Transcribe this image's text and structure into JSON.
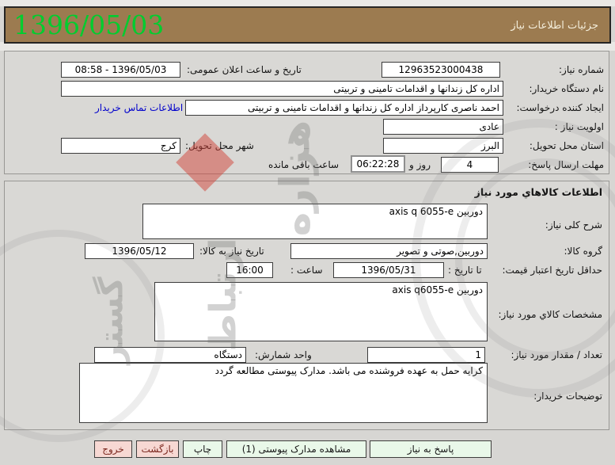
{
  "header": {
    "title": "جزئیات اطلاعات نیاز",
    "date": "1396/05/03",
    "colors": {
      "bar_bg": "#9c7b50",
      "date_green": "#00cd2f"
    }
  },
  "general": {
    "need_number_label": "شماره نیاز:",
    "need_number": "12963523000438",
    "announce_label": "تاریخ و ساعت اعلان عمومی:",
    "announce_value": "1396/05/03 - 08:58",
    "buyer_org_label": "نام دستگاه خریدار:",
    "buyer_org": "اداره کل زندانها و اقدامات تامینی و تربیتی",
    "requester_label": "ایجاد کننده درخواست:",
    "requester": "احمد ناصری کارپرداز اداره کل زندانها و اقدامات تامینی و تربیتی",
    "contact_link": "اطلاعات تماس خریدار",
    "priority_label": "اولویت نیاز :",
    "priority": "عادی",
    "province_label": "استان محل تحویل:",
    "province": "البرز",
    "city_label": "شهر محل تحویل:",
    "city": "کرج",
    "deadline_label": "مهلت ارسال پاسخ:",
    "deadline_days": "4",
    "deadline_days_unit": "روز و",
    "deadline_time": "06:22:28",
    "deadline_suffix": "ساعت باقی مانده"
  },
  "items": {
    "section_title": "اطلاعات کالاهاي مورد نیاز",
    "desc_label": "شرح کلی نیاز:",
    "desc": "دوربین axis q 6055-e",
    "group_label": "گروه کالا:",
    "group": "دوربین,صوتی و تصویر",
    "need_date_label": "تاریخ نیاز به کالا:",
    "need_date": "1396/05/12",
    "validity_label": "حداقل تاریخ اعتبار قیمت:",
    "until_label": "تا تاریخ :",
    "until_date": "1396/05/31",
    "hour_label": "ساعت :",
    "hour": "16:00",
    "specs_label": "مشخصات کالاي مورد نیاز:",
    "specs": "دوربین axis q6055-e",
    "qty_label": "تعداد / مقدار مورد نیاز:",
    "qty": "1",
    "unit_label": "واحد شمارش:",
    "unit": "دستگاه",
    "notes_label": "توضیحات خریدار:",
    "notes": "کرایه حمل به عهده فروشنده می باشد. مدارک پیوستی مطالعه گردد"
  },
  "buttons": {
    "respond": "پاسخ به نیاز",
    "attachments": "مشاهده مدارک پیوستی (1)",
    "print": "چاپ",
    "back": "بازگشت",
    "exit": "خروج",
    "colors": {
      "green_bg": "#e9f8e9",
      "pink_bg": "#f7d8d3",
      "link_blue": "#0000cc"
    }
  },
  "watermark": {
    "word1": "هزاره",
    "word2": "ارتباط",
    "word3": "گستر"
  }
}
